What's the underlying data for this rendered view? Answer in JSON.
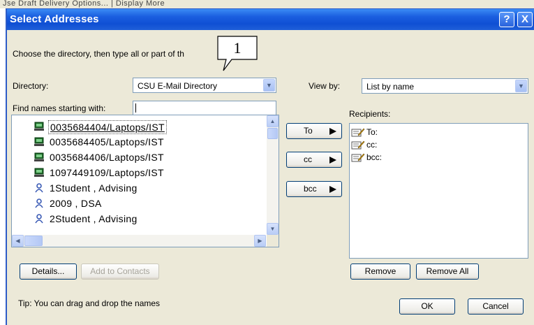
{
  "background_strip": "Jse Draft  Delivery Options...  |  Display  More",
  "window": {
    "title": "Select Addresses",
    "help_label": "?",
    "close_label": "X"
  },
  "instruction": "Choose the directory, then type all or part of th",
  "callout_number": "1",
  "directory": {
    "label": "Directory:",
    "value": "CSU E-Mail Directory"
  },
  "view_by": {
    "label": "View by:",
    "value": "List by name"
  },
  "find": {
    "label": "Find names starting with:",
    "value": ""
  },
  "names_list": {
    "items": [
      {
        "label": "0035684404/Laptops/IST",
        "icon": "computer-icon",
        "selected": true
      },
      {
        "label": "0035684405/Laptops/IST",
        "icon": "computer-icon",
        "selected": false
      },
      {
        "label": "0035684406/Laptops/IST",
        "icon": "computer-icon",
        "selected": false
      },
      {
        "label": "1097449109/Laptops/IST",
        "icon": "computer-icon",
        "selected": false
      },
      {
        "label": "1Student , Advising",
        "icon": "person-icon",
        "selected": false
      },
      {
        "label": "2009 , DSA",
        "icon": "person-icon",
        "selected": false
      },
      {
        "label": "2Student , Advising",
        "icon": "person-icon",
        "selected": false
      }
    ]
  },
  "add_buttons": {
    "to": "To",
    "cc": "cc",
    "bcc": "bcc"
  },
  "recipients": {
    "label": "Recipients:",
    "items": [
      {
        "label": "To:",
        "icon": "address-icon"
      },
      {
        "label": "cc:",
        "icon": "address-icon"
      },
      {
        "label": "bcc:",
        "icon": "address-icon"
      }
    ]
  },
  "buttons": {
    "details": "Details...",
    "add_to_contacts": "Add to Contacts",
    "remove": "Remove",
    "remove_all": "Remove All",
    "ok": "OK",
    "cancel": "Cancel"
  },
  "tip": "Tip: You can drag and drop the names",
  "colors": {
    "titlebar": "#0f4fd4",
    "dialog_bg": "#ece9d8",
    "button_border": "#003c74"
  }
}
